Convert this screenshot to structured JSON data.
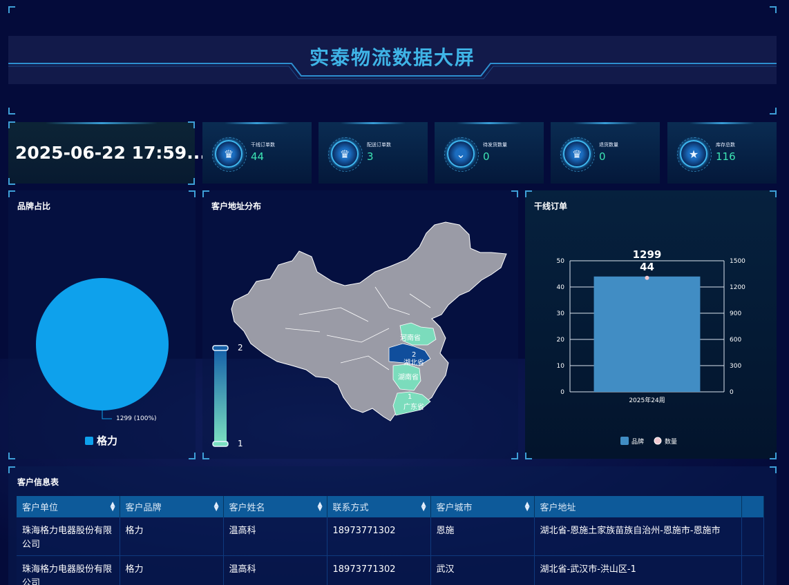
{
  "header": {
    "title": "实泰物流数据大屏"
  },
  "datetime": "2025-06-22 17:59...",
  "stats": [
    {
      "label": "干线订单数",
      "value": "44",
      "icon": "crown-icon"
    },
    {
      "label": "配送订单数",
      "value": "3",
      "icon": "crown-icon"
    },
    {
      "label": "待发货数量",
      "value": "0",
      "icon": "chevron-icon"
    },
    {
      "label": "退货数量",
      "value": "0",
      "icon": "crown-icon"
    },
    {
      "label": "库存总数",
      "value": "116",
      "icon": "star-icon"
    }
  ],
  "brand_panel": {
    "title": "品牌占比",
    "slice_label": "1299 (100%)",
    "legend": "格力",
    "color": "#0ea1ec"
  },
  "map_panel": {
    "title": "客户地址分布",
    "visual_max": "2",
    "visual_min": "1",
    "regions": [
      {
        "name": "河南省",
        "value": ""
      },
      {
        "name": "湖北省",
        "value": "2"
      },
      {
        "name": "湖南省",
        "value": ""
      },
      {
        "name": "广东省",
        "value": "1"
      }
    ]
  },
  "orders_panel": {
    "title": "干线订单"
  },
  "chart_data": {
    "type": "bar",
    "categories": [
      "2025年24周"
    ],
    "series": [
      {
        "name": "品牌",
        "values": [
          44
        ],
        "axis": "left",
        "color": "#418dc4"
      },
      {
        "name": "数量",
        "values": [
          1299
        ],
        "axis": "right",
        "color": "#f0c8d0"
      }
    ],
    "data_labels": [
      "1299",
      "44"
    ],
    "y_left_ticks": [
      "0",
      "10",
      "20",
      "30",
      "40",
      "50"
    ],
    "y_right_ticks": [
      "0",
      "300",
      "600",
      "900",
      "1200",
      "1500"
    ],
    "ylim_left": [
      0,
      50
    ],
    "ylim_right": [
      0,
      1500
    ],
    "legend": [
      "品牌",
      "数量"
    ],
    "legend_position": "bottom-center",
    "grid": true
  },
  "table": {
    "title": "客户信息表",
    "columns": [
      "客户单位",
      "客户品牌",
      "客户姓名",
      "联系方式",
      "客户城市",
      "客户地址"
    ],
    "rows": [
      [
        "珠海格力电器股份有限公司",
        "格力",
        "温高科",
        "18973771302",
        "恩施",
        "湖北省-恩施土家族苗族自治州-恩施市-恩施市"
      ],
      [
        "珠海格力电器股份有限公司",
        "格力",
        "温高科",
        "18973771302",
        "武汉",
        "湖北省-武汉市-洪山区-1"
      ]
    ]
  }
}
